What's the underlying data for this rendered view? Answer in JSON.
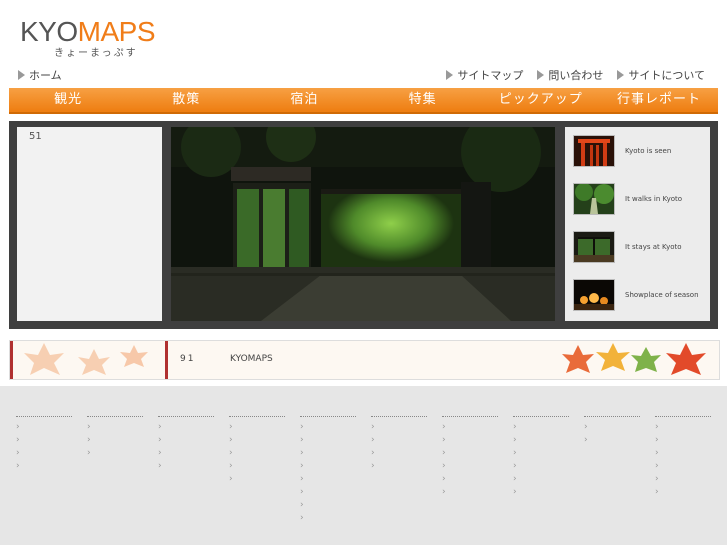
{
  "logo": {
    "brand_left": "KYO",
    "brand_right": "MAPS",
    "sub": "きょーまっぷす"
  },
  "breadcrumb": {
    "home": "ホーム"
  },
  "utility_links": [
    "サイトマップ",
    "問い合わせ",
    "サイトについて"
  ],
  "nav_tabs": [
    "観光",
    "散策",
    "宿泊",
    "特集",
    "ピックアップ",
    "行事レポート"
  ],
  "showcase": {
    "counter": "51",
    "thumbnails": [
      {
        "label": "Kyoto is seen",
        "icon": "torii-gates-thumbnail"
      },
      {
        "label": "It walks in Kyoto",
        "icon": "forest-path-thumbnail"
      },
      {
        "label": "It stays at Kyoto",
        "icon": "ryokan-room-thumbnail"
      },
      {
        "label": "Showplace of season",
        "icon": "night-illumination-thumbnail"
      }
    ]
  },
  "banner": {
    "number": "91",
    "title": "KYOMAPS"
  },
  "footer": {
    "columns": [
      {
        "items": 4
      },
      {
        "items": 3
      },
      {
        "items": 4
      },
      {
        "items": 5
      },
      {
        "items": 8
      },
      {
        "items": 4
      },
      {
        "items": 6
      },
      {
        "items": 6
      },
      {
        "items": 2
      },
      {
        "items": 6
      }
    ]
  },
  "colors": {
    "accent": "#f07d19",
    "nav_dark": "#d06a05",
    "panel_dark": "#3f3f3f",
    "banner_red": "#b03030"
  }
}
